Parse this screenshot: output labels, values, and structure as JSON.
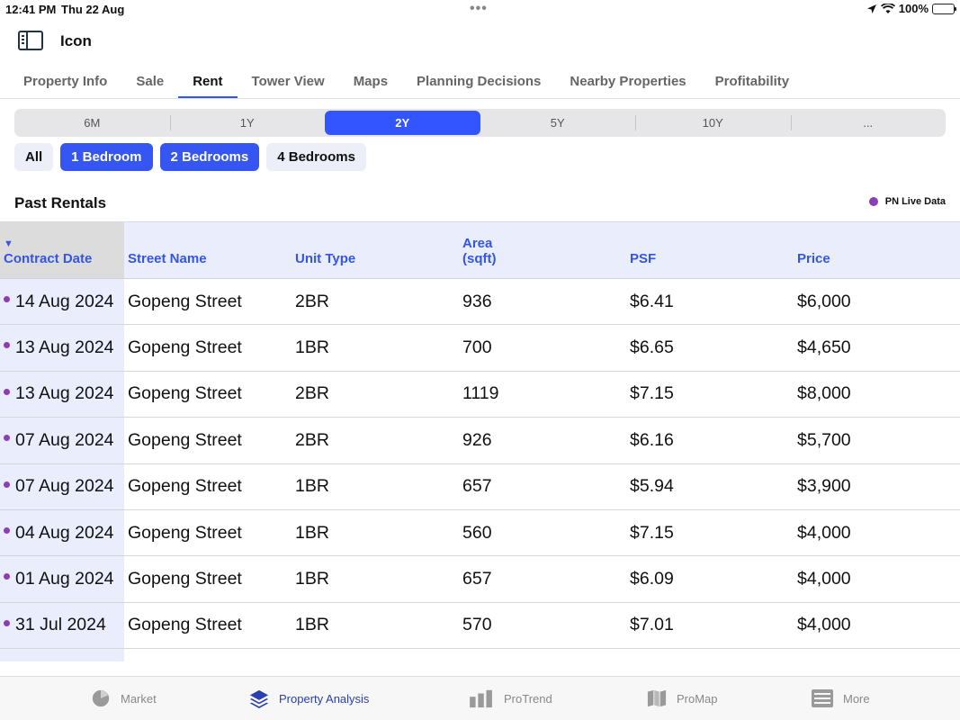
{
  "status_bar": {
    "time": "12:41 PM",
    "date": "Thu 22 Aug",
    "dots": "•••",
    "battery": "100%"
  },
  "header": {
    "title": "Icon"
  },
  "tabs": [
    {
      "label": "Property Info"
    },
    {
      "label": "Sale"
    },
    {
      "label": "Rent",
      "active": true
    },
    {
      "label": "Tower View"
    },
    {
      "label": "Maps"
    },
    {
      "label": "Planning Decisions"
    },
    {
      "label": "Nearby Properties"
    },
    {
      "label": "Profitability"
    }
  ],
  "periods": [
    "6M",
    "1Y",
    "2Y",
    "5Y",
    "10Y",
    "..."
  ],
  "selected_period": "2Y",
  "filters": [
    {
      "label": "All",
      "active": false
    },
    {
      "label": "1 Bedroom",
      "active": true
    },
    {
      "label": "2 Bedrooms",
      "active": true
    },
    {
      "label": "4 Bedrooms",
      "active": false
    }
  ],
  "section": {
    "title": "Past Rentals",
    "legend_label": "PN Live Data",
    "legend_color": "#8a3fb5"
  },
  "table": {
    "headers": {
      "date": "Contract Date",
      "street": "Street Name",
      "unit": "Unit Type",
      "area": "Area",
      "area_unit": "(sqft)",
      "psf": "PSF",
      "price": "Price"
    },
    "sort_indicator": "▼",
    "rows": [
      {
        "date": "14 Aug 2024",
        "street": "Gopeng Street",
        "unit": "2BR",
        "area": "936",
        "psf": "$6.41",
        "price": "$6,000"
      },
      {
        "date": "13 Aug 2024",
        "street": "Gopeng Street",
        "unit": "1BR",
        "area": "700",
        "psf": "$6.65",
        "price": "$4,650"
      },
      {
        "date": "13 Aug 2024",
        "street": "Gopeng Street",
        "unit": "2BR",
        "area": "1119",
        "psf": "$7.15",
        "price": "$8,000"
      },
      {
        "date": "07 Aug 2024",
        "street": "Gopeng Street",
        "unit": "2BR",
        "area": "926",
        "psf": "$6.16",
        "price": "$5,700"
      },
      {
        "date": "07 Aug 2024",
        "street": "Gopeng Street",
        "unit": "1BR",
        "area": "657",
        "psf": "$5.94",
        "price": "$3,900"
      },
      {
        "date": "04 Aug 2024",
        "street": "Gopeng Street",
        "unit": "1BR",
        "area": "560",
        "psf": "$7.15",
        "price": "$4,000"
      },
      {
        "date": "01 Aug 2024",
        "street": "Gopeng Street",
        "unit": "1BR",
        "area": "657",
        "psf": "$6.09",
        "price": "$4,000"
      },
      {
        "date": "31 Jul 2024",
        "street": "Gopeng Street",
        "unit": "1BR",
        "area": "570",
        "psf": "$7.01",
        "price": "$4,000"
      }
    ]
  },
  "bottom_nav": [
    {
      "label": "Market",
      "icon": "pie-chart-icon"
    },
    {
      "label": "Property Analysis",
      "icon": "layers-icon",
      "active": true
    },
    {
      "label": "ProTrend",
      "icon": "bar-chart-icon"
    },
    {
      "label": "ProMap",
      "icon": "map-icon"
    },
    {
      "label": "More",
      "icon": "list-icon"
    }
  ],
  "colors": {
    "accent": "#3355ff",
    "live_dot": "#8a3fb5",
    "header_bg": "#eaedfb",
    "nav_active": "#2a3fb0"
  }
}
